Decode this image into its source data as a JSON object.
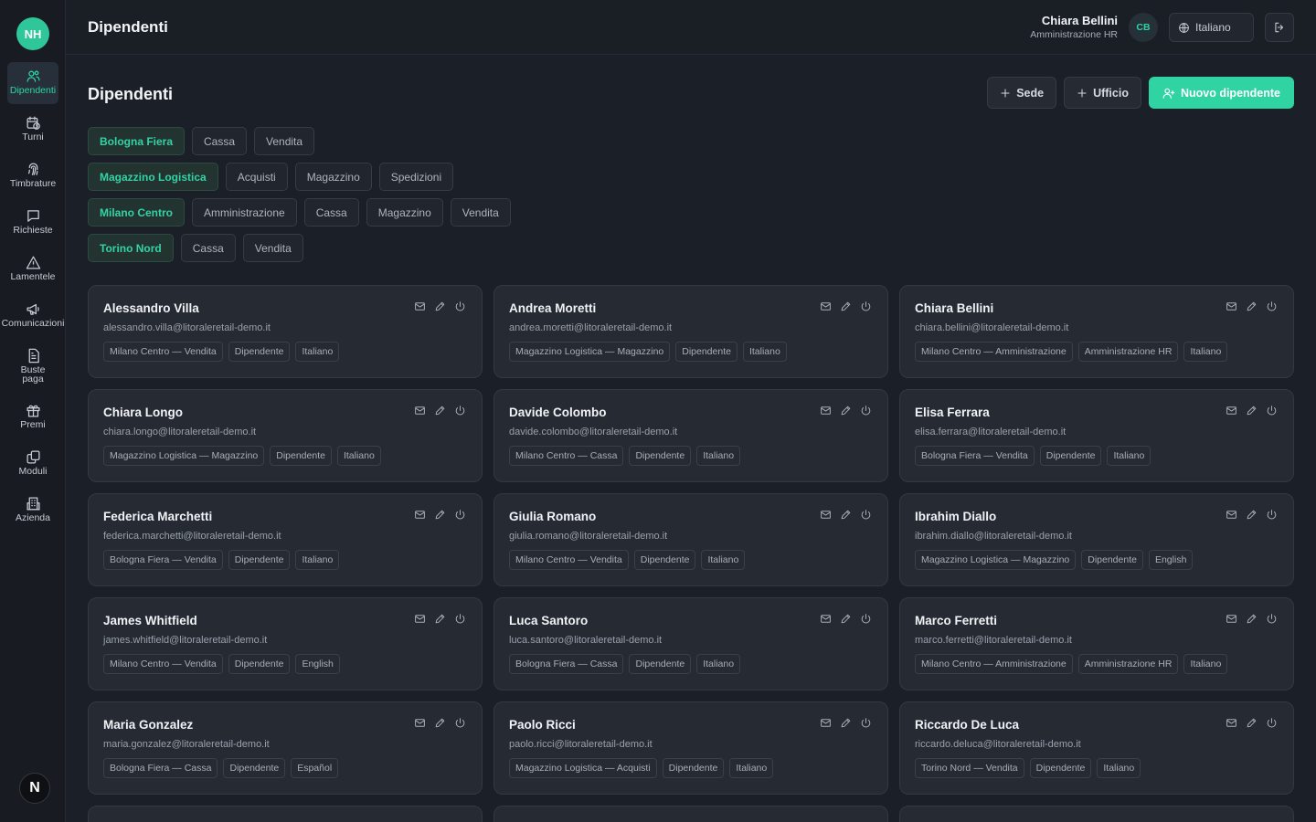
{
  "brand": {
    "initials": "NH"
  },
  "sidebar": {
    "items": [
      {
        "label": "Dipendenti",
        "icon": "users-icon"
      },
      {
        "label": "Turni",
        "icon": "calendar-clock-icon"
      },
      {
        "label": "Timbrature",
        "icon": "fingerprint-icon"
      },
      {
        "label": "Richieste",
        "icon": "message-icon"
      },
      {
        "label": "Lamentele",
        "icon": "alert-triangle-icon"
      },
      {
        "label": "Comunicazioni",
        "icon": "megaphone-icon"
      },
      {
        "label": "Buste paga",
        "icon": "file-text-icon"
      },
      {
        "label": "Premi",
        "icon": "gift-icon"
      },
      {
        "label": "Moduli",
        "icon": "copy-icon"
      },
      {
        "label": "Azienda",
        "icon": "building-icon"
      }
    ],
    "bottom_badge": "N"
  },
  "header": {
    "title": "Dipendenti",
    "user_name": "Chiara Bellini",
    "user_role": "Amministrazione HR",
    "avatar_initials": "CB",
    "language": "Italiano"
  },
  "page": {
    "title": "Dipendenti",
    "btn_sede": "Sede",
    "btn_ufficio": "Ufficio",
    "btn_new": "Nuovo dipendente"
  },
  "filters": [
    {
      "site": "Bologna Fiera",
      "depts": [
        "Cassa",
        "Vendita"
      ]
    },
    {
      "site": "Magazzino Logistica",
      "depts": [
        "Acquisti",
        "Magazzino",
        "Spedizioni"
      ]
    },
    {
      "site": "Milano Centro",
      "depts": [
        "Amministrazione",
        "Cassa",
        "Magazzino",
        "Vendita"
      ]
    },
    {
      "site": "Torino Nord",
      "depts": [
        "Cassa",
        "Vendita"
      ]
    }
  ],
  "employees": [
    {
      "name": "Alessandro Villa",
      "email": "alessandro.villa@litoraleretail-demo.it",
      "location": "Milano Centro — Vendita",
      "role": "Dipendente",
      "lang": "Italiano"
    },
    {
      "name": "Andrea Moretti",
      "email": "andrea.moretti@litoraleretail-demo.it",
      "location": "Magazzino Logistica — Magazzino",
      "role": "Dipendente",
      "lang": "Italiano"
    },
    {
      "name": "Chiara Bellini",
      "email": "chiara.bellini@litoraleretail-demo.it",
      "location": "Milano Centro — Amministrazione",
      "role": "Amministrazione HR",
      "lang": "Italiano"
    },
    {
      "name": "Chiara Longo",
      "email": "chiara.longo@litoraleretail-demo.it",
      "location": "Magazzino Logistica — Magazzino",
      "role": "Dipendente",
      "lang": "Italiano"
    },
    {
      "name": "Davide Colombo",
      "email": "davide.colombo@litoraleretail-demo.it",
      "location": "Milano Centro — Cassa",
      "role": "Dipendente",
      "lang": "Italiano"
    },
    {
      "name": "Elisa Ferrara",
      "email": "elisa.ferrara@litoraleretail-demo.it",
      "location": "Bologna Fiera — Vendita",
      "role": "Dipendente",
      "lang": "Italiano"
    },
    {
      "name": "Federica Marchetti",
      "email": "federica.marchetti@litoraleretail-demo.it",
      "location": "Bologna Fiera — Vendita",
      "role": "Dipendente",
      "lang": "Italiano"
    },
    {
      "name": "Giulia Romano",
      "email": "giulia.romano@litoraleretail-demo.it",
      "location": "Milano Centro — Vendita",
      "role": "Dipendente",
      "lang": "Italiano"
    },
    {
      "name": "Ibrahim Diallo",
      "email": "ibrahim.diallo@litoraleretail-demo.it",
      "location": "Magazzino Logistica — Magazzino",
      "role": "Dipendente",
      "lang": "English"
    },
    {
      "name": "James Whitfield",
      "email": "james.whitfield@litoraleretail-demo.it",
      "location": "Milano Centro — Vendita",
      "role": "Dipendente",
      "lang": "English"
    },
    {
      "name": "Luca Santoro",
      "email": "luca.santoro@litoraleretail-demo.it",
      "location": "Bologna Fiera — Cassa",
      "role": "Dipendente",
      "lang": "Italiano"
    },
    {
      "name": "Marco Ferretti",
      "email": "marco.ferretti@litoraleretail-demo.it",
      "location": "Milano Centro — Amministrazione",
      "role": "Amministrazione HR",
      "lang": "Italiano"
    },
    {
      "name": "Maria Gonzalez",
      "email": "maria.gonzalez@litoraleretail-demo.it",
      "location": "Bologna Fiera — Cassa",
      "role": "Dipendente",
      "lang": "Español"
    },
    {
      "name": "Paolo Ricci",
      "email": "paolo.ricci@litoraleretail-demo.it",
      "location": "Magazzino Logistica — Acquisti",
      "role": "Dipendente",
      "lang": "Italiano"
    },
    {
      "name": "Riccardo De Luca",
      "email": "riccardo.deluca@litoraleretail-demo.it",
      "location": "Torino Nord — Vendita",
      "role": "Dipendente",
      "lang": "Italiano"
    }
  ],
  "colors": {
    "accent": "#2fd4a2",
    "background": "#1b1f27",
    "card": "#252a33"
  }
}
